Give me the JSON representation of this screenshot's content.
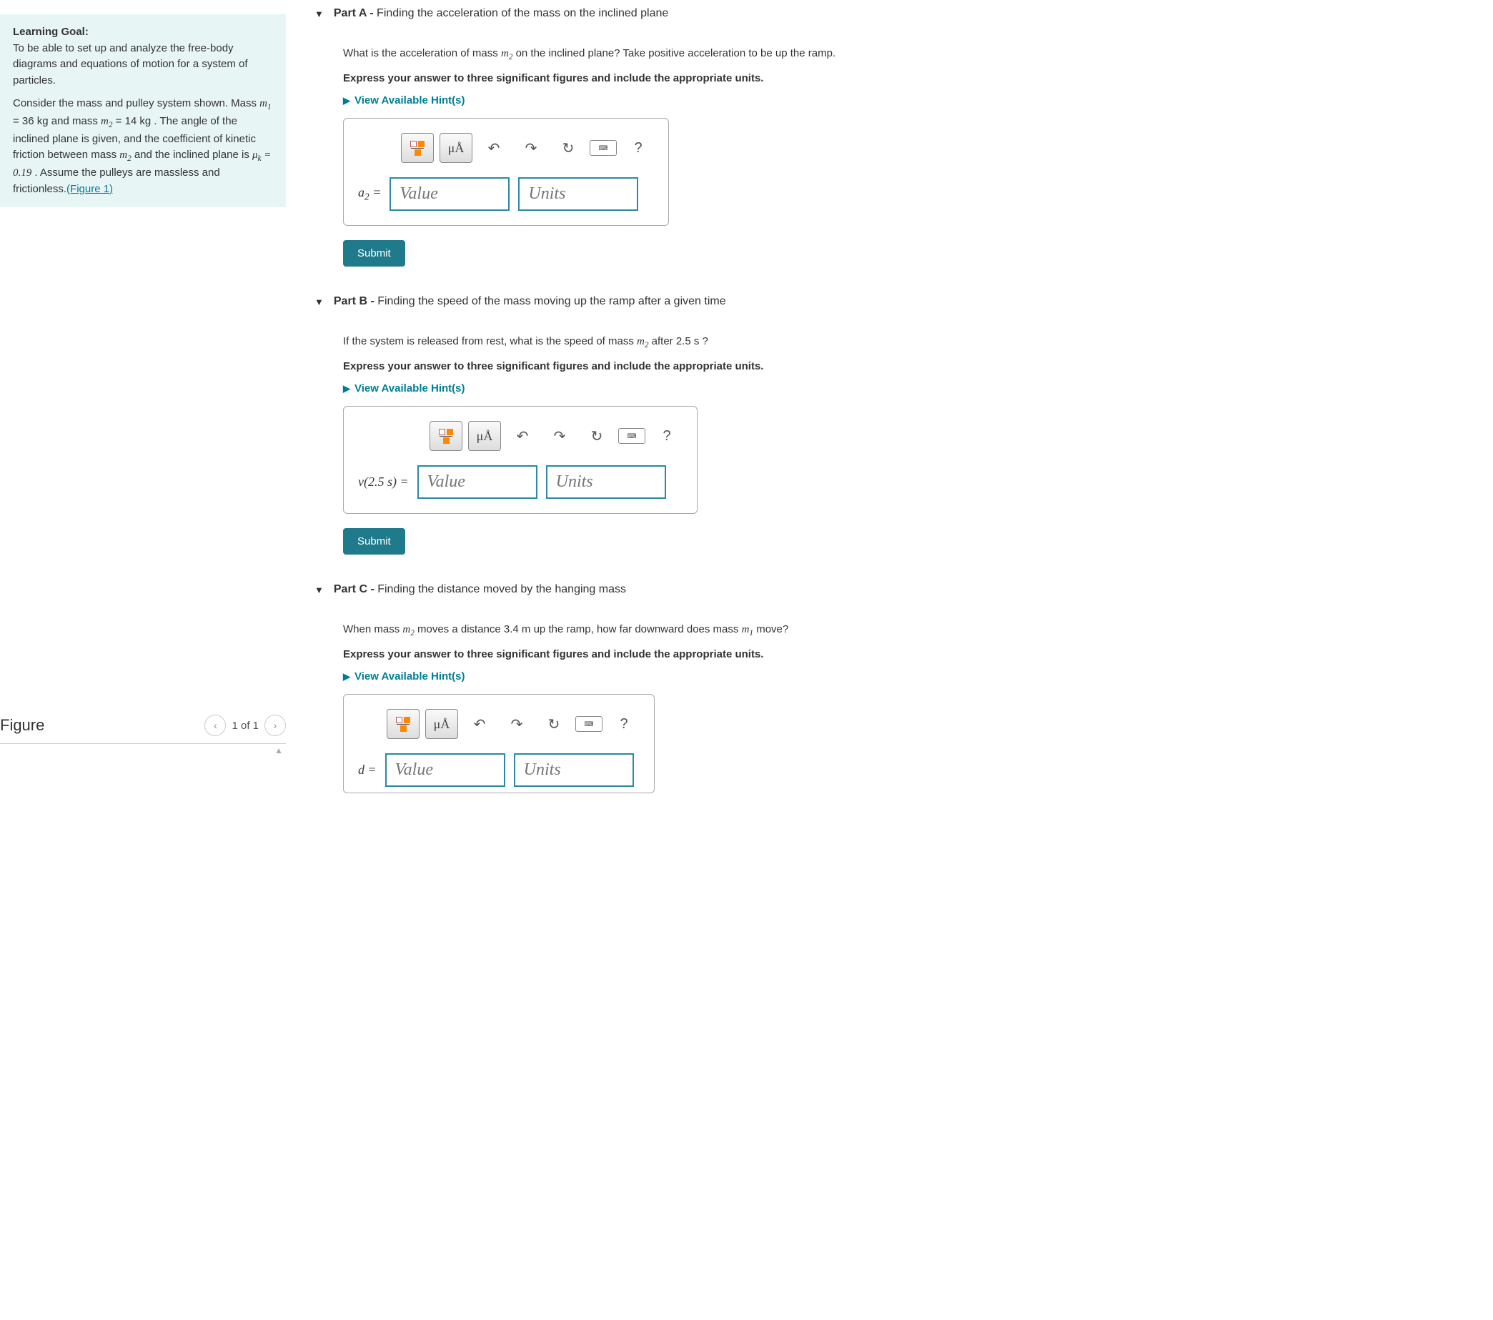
{
  "intro": {
    "goal_heading": "Learning Goal:",
    "goal_text": "To be able to set up and analyze the free-body diagrams and equations of motion for a system of particles.",
    "desc_prefix": "Consider the mass and pulley system shown. Mass ",
    "m1_var": "m",
    "m1_sub": "1",
    "m1_eq": " = 36 ",
    "m1_unit": "kg",
    "desc_and": " and mass ",
    "m2_var": "m",
    "m2_sub": "2",
    "m2_eq": " = 14 ",
    "m2_unit": "kg",
    "desc_angle": " . The angle of the inclined plane is given, and the coefficient of kinetic friction between mass ",
    "m2b_var": "m",
    "m2b_sub": "2",
    "desc_plane": " and the inclined plane is ",
    "muk_var": "μ",
    "muk_sub": "k",
    "muk_eq": " = 0.19",
    "desc_end": " . Assume the pulleys are massless and frictionless.",
    "figure_link": "(Figure 1)"
  },
  "figure": {
    "title": "Figure",
    "page": "1 of 1"
  },
  "parts": {
    "a": {
      "label_bold": "Part A -",
      "label_rest": " Finding the acceleration of  the mass on the inclined plane",
      "q_prefix": "What is the acceleration of mass ",
      "q_var": "m",
      "q_sub": "2",
      "q_suffix": " on the inclined plane? Take positive acceleration to be up the ramp.",
      "instructions": "Express your answer to three significant figures and include the appropriate units.",
      "hints": "View Available Hint(s)",
      "var_label": "a",
      "var_sub": "2",
      "eq": " =",
      "value_ph": "Value",
      "units_ph": "Units",
      "submit": "Submit"
    },
    "b": {
      "label_bold": "Part B -",
      "label_rest": " Finding the speed of the mass moving up the ramp after a given time",
      "q_prefix": "If the system is released from rest, what is the speed of mass ",
      "q_var": "m",
      "q_sub": "2",
      "q_after": " after ",
      "q_time": "2.5 ",
      "q_unit": "s",
      "q_end": " ?",
      "instructions": "Express your answer to three significant figures and include the appropriate units.",
      "hints": "View Available Hint(s)",
      "var_label": "v(2.5 s) =",
      "value_ph": "Value",
      "units_ph": "Units",
      "submit": "Submit"
    },
    "c": {
      "label_bold": "Part C -",
      "label_rest": " Finding the distance moved by the hanging mass",
      "q_prefix": "When mass ",
      "q_var": "m",
      "q_sub": "2",
      "q_mid": " moves a distance ",
      "q_dist": "3.4 ",
      "q_unit": "m",
      "q_mid2": " up the ramp, how far downward does mass ",
      "q_var2": "m",
      "q_sub2": "1",
      "q_end": " move?",
      "instructions": "Express your answer to three significant figures and include the appropriate units.",
      "hints": "View Available Hint(s)",
      "var_label": "d",
      "eq": " =",
      "value_ph": "Value",
      "units_ph": "Units"
    }
  },
  "toolbar": {
    "units_btn": "μÅ",
    "help": "?"
  }
}
